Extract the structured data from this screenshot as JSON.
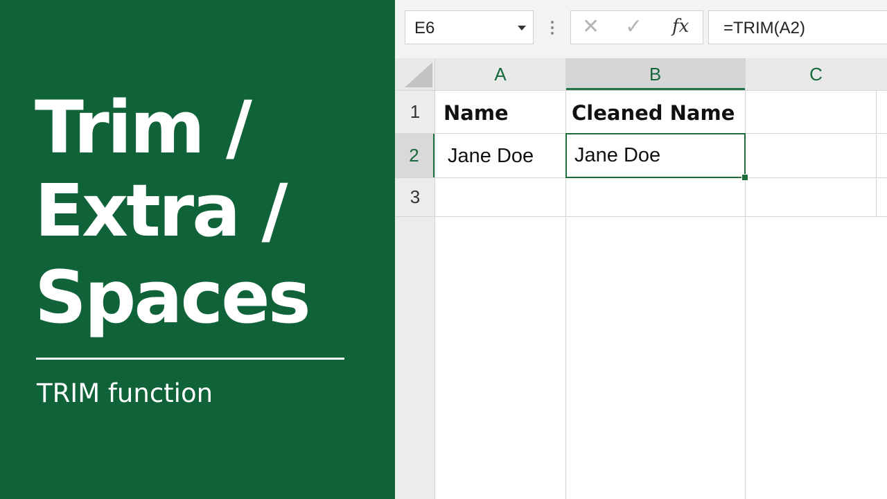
{
  "panel": {
    "title_lines": [
      "Trim /",
      "Extra /",
      "Spaces"
    ],
    "subtitle": "TRIM function",
    "background_color": "#106239"
  },
  "formula_bar": {
    "name_box": "E6",
    "icons": [
      "cancel-icon",
      "enter-icon",
      "fx-icon"
    ],
    "fx_label": "fx",
    "formula": "=TRIM(A2)"
  },
  "grid": {
    "columns": [
      "A",
      "B",
      "C"
    ],
    "rows": [
      "1",
      "2",
      "3"
    ],
    "cells": {
      "A1": "Name",
      "B1": "Cleaned Name",
      "A2": "Jane Doe",
      "B2": "Jane Doe"
    },
    "accent_color": "#217346"
  }
}
